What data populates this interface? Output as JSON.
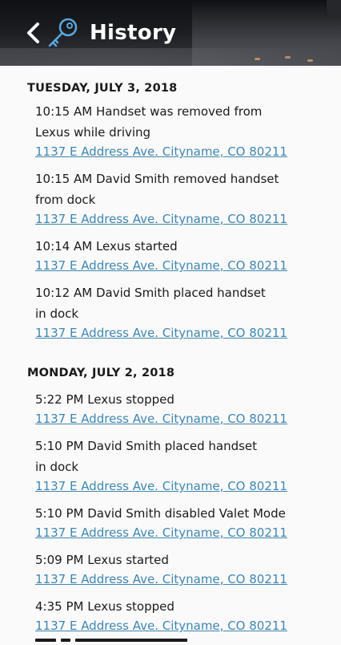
{
  "header": {
    "title": "History"
  },
  "days": [
    {
      "label": "TUESDAY, JULY 3, 2018",
      "entries": [
        {
          "line1": "10:15 AM Handset was removed from",
          "line2": "Lexus while driving",
          "address": "1137 E Address Ave. Cityname, CO 80211"
        },
        {
          "line1": "10:15 AM David Smith removed handset",
          "line2": "from dock",
          "address": "1137 E Address Ave. Cityname, CO 80211"
        },
        {
          "line1": "10:14 AM Lexus started",
          "line2": "",
          "address": "1137 E Address Ave. Cityname, CO 80211"
        },
        {
          "line1": "10:12 AM David Smith placed handset",
          "line2": "in dock",
          "address": "1137 E Address Ave. Cityname, CO 80211"
        }
      ]
    },
    {
      "label": "MONDAY, JULY 2, 2018",
      "entries": [
        {
          "line1": "5:22 PM Lexus stopped",
          "line2": "",
          "address": "1137 E Address Ave. Cityname, CO 80211"
        },
        {
          "line1": "5:10 PM David Smith placed handset",
          "line2": "in dock",
          "address": "1137 E Address Ave. Cityname, CO 80211"
        },
        {
          "line1": "5:10 PM David Smith disabled Valet Mode",
          "line2": "",
          "address": "1137 E Address Ave. Cityname, CO 80211"
        },
        {
          "line1": "5:09 PM Lexus started",
          "line2": "",
          "address": "1137 E Address Ave. Cityname, CO 80211"
        },
        {
          "line1": "4:35 PM Lexus stopped",
          "line2": "",
          "address": "1137 E Address Ave. Cityname, CO 80211"
        }
      ]
    }
  ],
  "colors": {
    "link": "#3f86b0",
    "key_icon": "#5aa7e0",
    "text": "#1a1a1a",
    "background": "#fafafa"
  },
  "icons": {
    "back": "chevron-left-icon",
    "brand": "key-icon"
  }
}
